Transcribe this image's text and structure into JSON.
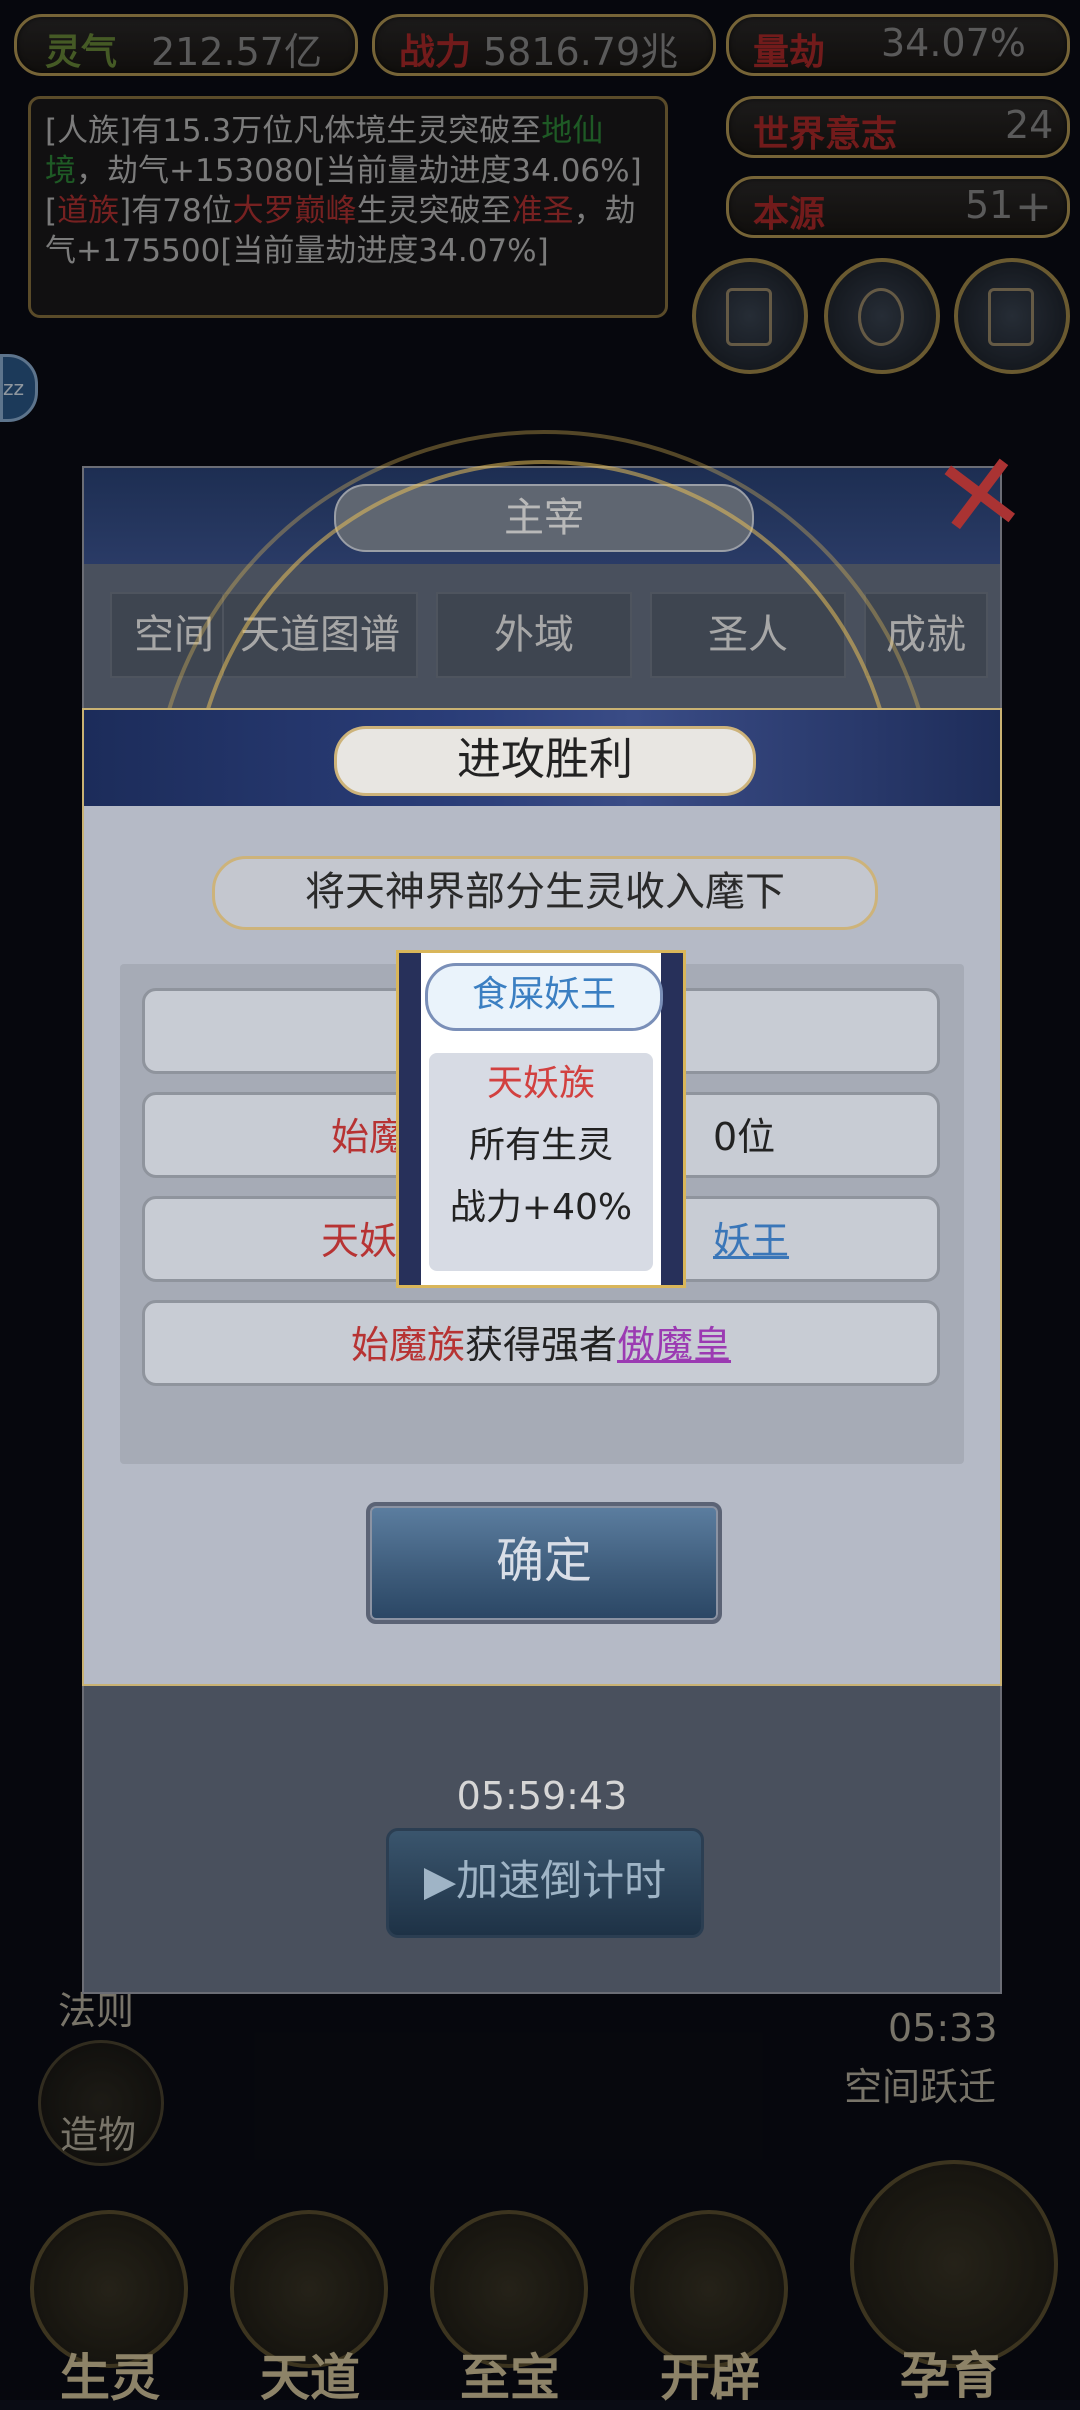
{
  "resources": {
    "lingqi_label": "灵气",
    "lingqi_value": "212.57亿",
    "zhanli_label": "战力",
    "zhanli_value": "5816.79兆",
    "liangjie_label": "量劫",
    "liangjie_value": "34.07%",
    "shijieyizhi_label": "世界意志",
    "shijieyizhi_value": "24",
    "benyuan_label": "本源",
    "benyuan_value": "51"
  },
  "log": {
    "line1_prefix": "[人族]有15.3万位凡体境生灵突破至",
    "line1_realm": "地仙境",
    "line1_suffix": "，劫气+153080[当前量劫进度34.06%]",
    "line2_race": "道族",
    "line2_mid": "有78位",
    "line2_realm": "大罗巅峰",
    "line2_mid2": "生灵突破至",
    "line2_target": "准圣",
    "line2_suffix": "，劫气+175500[当前量劫进度34.07%]"
  },
  "back_window": {
    "title": "主宰",
    "tabs": [
      "空间",
      "天道图谱",
      "外域",
      "圣人",
      "成就"
    ]
  },
  "dialog": {
    "title": "进攻胜利",
    "subtitle": "将天神界部分生灵收入麾下",
    "row1": "",
    "row2_race": "始魔",
    "row2_tail": "0位",
    "row3_race": "天妖",
    "row3_link": "妖王",
    "row4_race": "始魔族",
    "row4_text": "获得强者",
    "row4_link": "傲魔皇",
    "confirm": "确定"
  },
  "popup": {
    "title": "食屎妖王",
    "race": "天妖族",
    "line2": "所有生灵",
    "line3": "战力+40%"
  },
  "timer": "05:59:43",
  "speed_button": "▶加速倒计时",
  "side": {
    "left_bottom": "造物",
    "left_law": "法则",
    "right_time": "05:33",
    "right_jump": "空间跃迁"
  },
  "nav": [
    "生灵",
    "天道",
    "至宝",
    "开辟",
    "孕育"
  ]
}
